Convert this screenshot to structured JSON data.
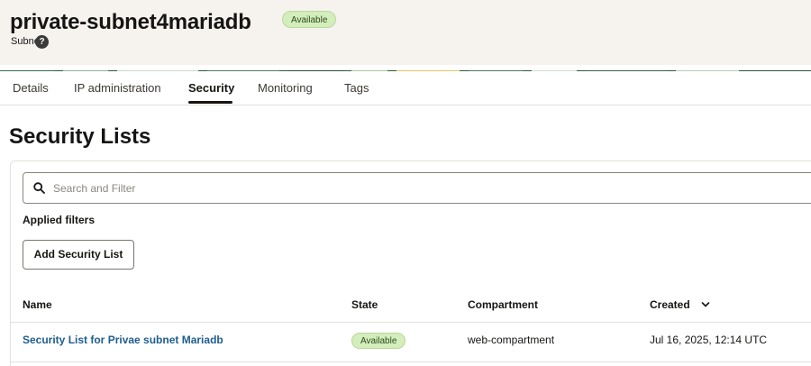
{
  "header": {
    "title": "private-subnet4mariadb",
    "status_badge": "Available",
    "resource_type": "Subnet",
    "help_icon": "question-circle-icon"
  },
  "tabs": [
    {
      "label": "Details",
      "active": false
    },
    {
      "label": "IP administration",
      "active": false
    },
    {
      "label": "Security",
      "active": true
    },
    {
      "label": "Monitoring",
      "active": false
    },
    {
      "label": "Tags",
      "active": false
    }
  ],
  "main": {
    "page_title": "Security Lists",
    "search": {
      "placeholder": "Search and Filter",
      "value": "",
      "icon": "search-icon"
    },
    "applied_filters_label": "Applied filters",
    "add_button_label": "Add Security List",
    "table": {
      "columns": [
        "Name",
        "State",
        "Compartment",
        "Created"
      ],
      "sorted_column": "Created",
      "rows": [
        {
          "name": "Security List for Privae subnet Mariadb",
          "state": "Available",
          "compartment": "web-compartment",
          "created": "Jul 16, 2025, 12:14 UTC"
        }
      ]
    }
  },
  "colors": {
    "header_bg": "#f6f3ef",
    "badge_bg": "#d4edbc",
    "link": "#1e5d8f",
    "text": "#161513"
  }
}
